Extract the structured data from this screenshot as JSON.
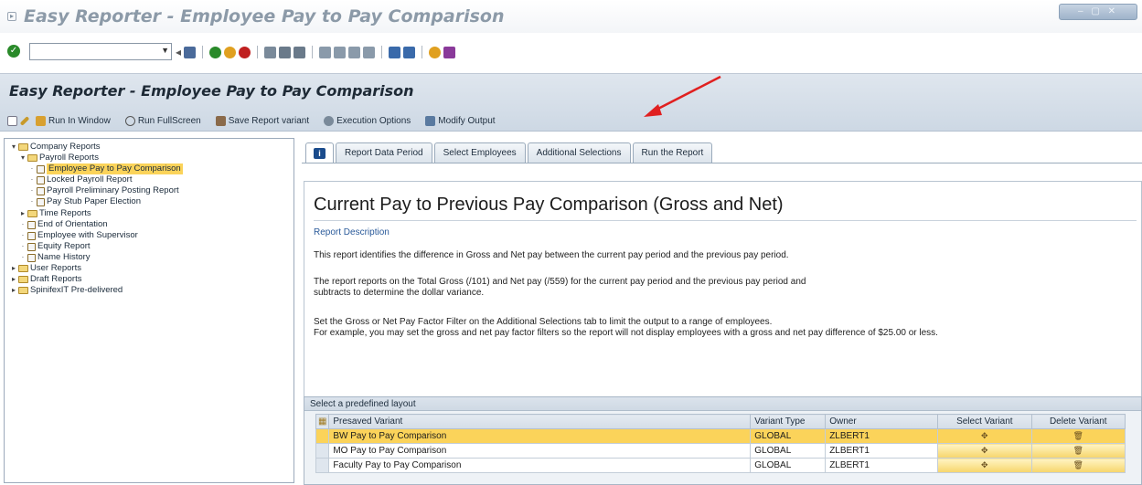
{
  "window": {
    "title": "Easy Reporter  - Employee Pay to Pay Comparison",
    "controls": "– ▢ ✕"
  },
  "system_toolbar": {
    "command_field_value": "",
    "icons": [
      "save-icon",
      "back-icon",
      "exit-icon",
      "cancel-icon",
      "print-icon",
      "find-icon",
      "find-next-icon",
      "first-page-icon",
      "previous-page-icon",
      "next-page-icon",
      "last-page-icon",
      "create-session-icon",
      "shortcut-icon",
      "help-icon",
      "layout-menu-icon"
    ]
  },
  "header": {
    "title": "Easy Reporter  - Employee Pay to Pay Comparison"
  },
  "app_toolbar": {
    "run_in_window": "Run In Window",
    "run_fullscreen": "Run FullScreen",
    "save_variant": "Save Report variant",
    "execution_options": "Execution Options",
    "modify_output": "Modify Output"
  },
  "tree": [
    {
      "label": "Company Reports",
      "type": "folder",
      "level": 0,
      "expanded": true
    },
    {
      "label": "Payroll Reports",
      "type": "folder",
      "level": 1,
      "expanded": true
    },
    {
      "label": "Employee Pay to Pay Comparison",
      "type": "report",
      "level": 2,
      "selected": true
    },
    {
      "label": "Locked Payroll Report",
      "type": "report",
      "level": 2
    },
    {
      "label": "Payroll Preliminary Posting Report",
      "type": "report",
      "level": 2
    },
    {
      "label": "Pay Stub Paper Election",
      "type": "report",
      "level": 2
    },
    {
      "label": "Time Reports",
      "type": "folder",
      "level": 1,
      "expanded": false
    },
    {
      "label": "End of Orientation",
      "type": "report",
      "level": 1
    },
    {
      "label": "Employee with Supervisor",
      "type": "report",
      "level": 1
    },
    {
      "label": "Equity Report",
      "type": "report",
      "level": 1
    },
    {
      "label": "Name History",
      "type": "report",
      "level": 1
    },
    {
      "label": "User Reports",
      "type": "folder",
      "level": 0,
      "expanded": false
    },
    {
      "label": "Draft Reports",
      "type": "folder",
      "level": 0,
      "expanded": false
    },
    {
      "label": "SpinifexIT Pre-delivered",
      "type": "folder",
      "level": 0,
      "expanded": false
    }
  ],
  "tabs": {
    "info": "i",
    "items": [
      "Report Data Period",
      "Select Employees",
      "Additional Selections",
      "Run the Report"
    ]
  },
  "content": {
    "title": "Current Pay to Previous Pay Comparison (Gross and Net)",
    "description_label": "Report Description",
    "p1": "This report identifies the difference in Gross and Net pay between the current pay period and the previous pay period.",
    "p2a": "The report reports on the Total Gross (/101) and Net pay (/559) for the current pay period and the previous pay period and",
    "p2b": "subtracts to determine the dollar variance.",
    "p3a": "Set the Gross or Net Pay Factor Filter on the Additional Selections tab to limit the output to a range of employees.",
    "p3b": "For example, you may set the gross and net pay factor filters so the report will not display employees with a gross and net pay difference of $25.00 or less."
  },
  "layout": {
    "header": "Select a predefined layout",
    "columns": [
      "Presaved Variant",
      "Variant Type",
      "Owner",
      "Select Variant",
      "Delete Variant"
    ],
    "rows": [
      {
        "variant": "BW Pay to Pay Comparison",
        "type": "GLOBAL",
        "owner": "ZLBERT1"
      },
      {
        "variant": "MO Pay to Pay Comparison",
        "type": "GLOBAL",
        "owner": "ZLBERT1"
      },
      {
        "variant": "Faculty Pay to Pay Comparison",
        "type": "GLOBAL",
        "owner": "ZLBERT1"
      }
    ]
  }
}
